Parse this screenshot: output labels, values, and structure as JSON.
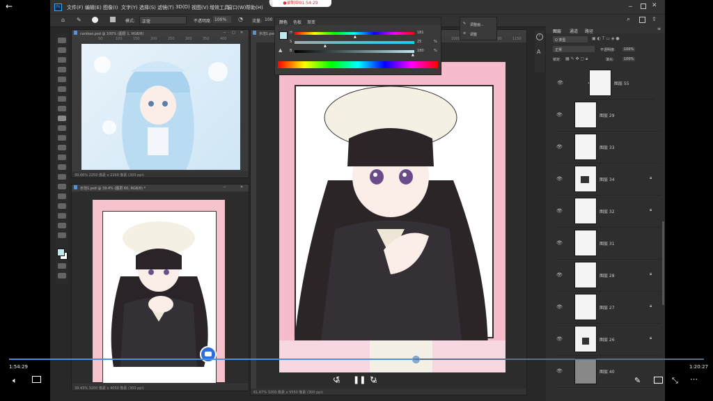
{
  "player": {
    "time_current": "1:54:29",
    "time_total": "1:20:27",
    "rewind_label": "10",
    "forward_label": "30",
    "progress_fraction": 0.585,
    "recording_badge": "●录制中01:54:29"
  },
  "menu": {
    "items": [
      "文件(F)",
      "编辑(E)",
      "图像(I)",
      "文字(Y)",
      "选择(S)",
      "滤镜(T)",
      "3D(D)",
      "视图(V)",
      "增效工具",
      "窗口(W)",
      "帮助(H)"
    ]
  },
  "options": {
    "mode_label": "模式:",
    "mode_value": "正常",
    "opacity_label": "不透明度:",
    "opacity_value": "100%",
    "flow_label": "流量:",
    "flow_value": "100"
  },
  "color_panel": {
    "tabs": [
      "颜色",
      "色板",
      "渐变"
    ],
    "rows": [
      {
        "label": "H",
        "value": "181",
        "unit": ""
      },
      {
        "label": "S",
        "value": "25",
        "unit": "%"
      },
      {
        "label": "B",
        "value": "180",
        "unit": "%"
      }
    ]
  },
  "properties_popup": {
    "item1": "调整画...",
    "item2": "调整"
  },
  "documents": {
    "ref_title": "canikao.psd @ 100% (图层 1, RGB/8)",
    "ref_status": "99.66%   2250 像素 x 2269 像素 (300 ppi)",
    "small_title": "示范1.psd @ 39.4% (图层 60, RGB/8) *",
    "small_status": "39.43%   3200 像素 x 4050 像素 (300 ppi)",
    "main_title": "示范1.psd",
    "main_status": "61.67%   3200 像素 x 5550 像素 (300 ppi)",
    "ruler_ticks_ref": [
      "50",
      "100",
      "150",
      "200",
      "250",
      "300",
      "350",
      "400"
    ],
    "ruler_ticks_main": [
      "750",
      "800",
      "850",
      "900",
      "950",
      "1000",
      "1050",
      "1100",
      "1150"
    ]
  },
  "layers_panel": {
    "tabs": [
      "图层",
      "通道",
      "路径"
    ],
    "kind_label": "Q 类型",
    "blend_mode": "正常",
    "opacity_label": "不透明度:",
    "opacity_value": "100%",
    "lock_label": "锁定:",
    "fill_label": "填充:",
    "fill_value": "100%",
    "layers": [
      {
        "name": "图层 55",
        "locked": false
      },
      {
        "name": "图层 29",
        "locked": false
      },
      {
        "name": "图层 33",
        "locked": false
      },
      {
        "name": "图层 34",
        "locked": true
      },
      {
        "name": "图层 32",
        "locked": true
      },
      {
        "name": "图层 31",
        "locked": false
      },
      {
        "name": "图层 28",
        "locked": true
      },
      {
        "name": "图层 27",
        "locked": true
      },
      {
        "name": "图层 26",
        "locked": true
      },
      {
        "name": "图层 40",
        "locked": false
      }
    ]
  },
  "colors": {
    "accent": "#4a90e2",
    "pink_border": "#f2b3c0",
    "ps_bg": "#282828"
  }
}
